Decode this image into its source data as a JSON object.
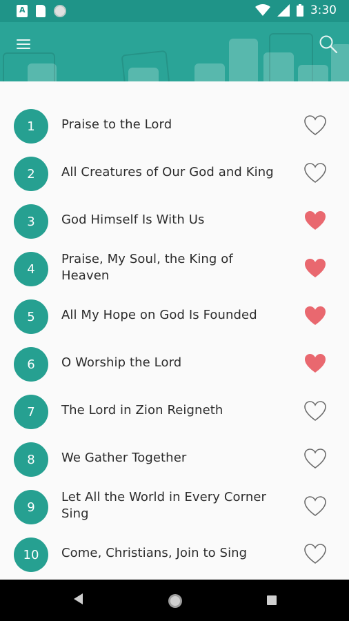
{
  "status_bar": {
    "time": "3:30",
    "left_icons": [
      "app-notification-icon",
      "sd-card-icon",
      "sync-icon"
    ],
    "right_icons": [
      "wifi-icon",
      "signal-icon",
      "battery-icon"
    ]
  },
  "header": {
    "menu_icon": "hamburger-menu-icon",
    "search_icon": "search-icon",
    "color": "#2aa497"
  },
  "hymns": [
    {
      "number": "1",
      "title": "Praise to the Lord",
      "favorite": false
    },
    {
      "number": "2",
      "title": "All Creatures of Our God and King",
      "favorite": false
    },
    {
      "number": "3",
      "title": "God Himself Is With Us",
      "favorite": true
    },
    {
      "number": "4",
      "title": "Praise, My Soul, the King of Heaven",
      "favorite": true
    },
    {
      "number": "5",
      "title": "All My Hope on God Is Founded",
      "favorite": true
    },
    {
      "number": "6",
      "title": "O Worship the Lord",
      "favorite": true
    },
    {
      "number": "7",
      "title": "The Lord in Zion Reigneth",
      "favorite": false
    },
    {
      "number": "8",
      "title": "We Gather Together",
      "favorite": false
    },
    {
      "number": "9",
      "title": "Let All the World in Every Corner Sing",
      "favorite": false
    },
    {
      "number": "10",
      "title": " Come, Christians, Join to Sing",
      "favorite": false
    }
  ],
  "colors": {
    "accent": "#26a091",
    "heart_filled": "#e9686f",
    "heart_outline": "#6b6b6b"
  },
  "nav_bar": {
    "buttons": [
      "back-icon",
      "home-icon",
      "recents-icon"
    ]
  }
}
